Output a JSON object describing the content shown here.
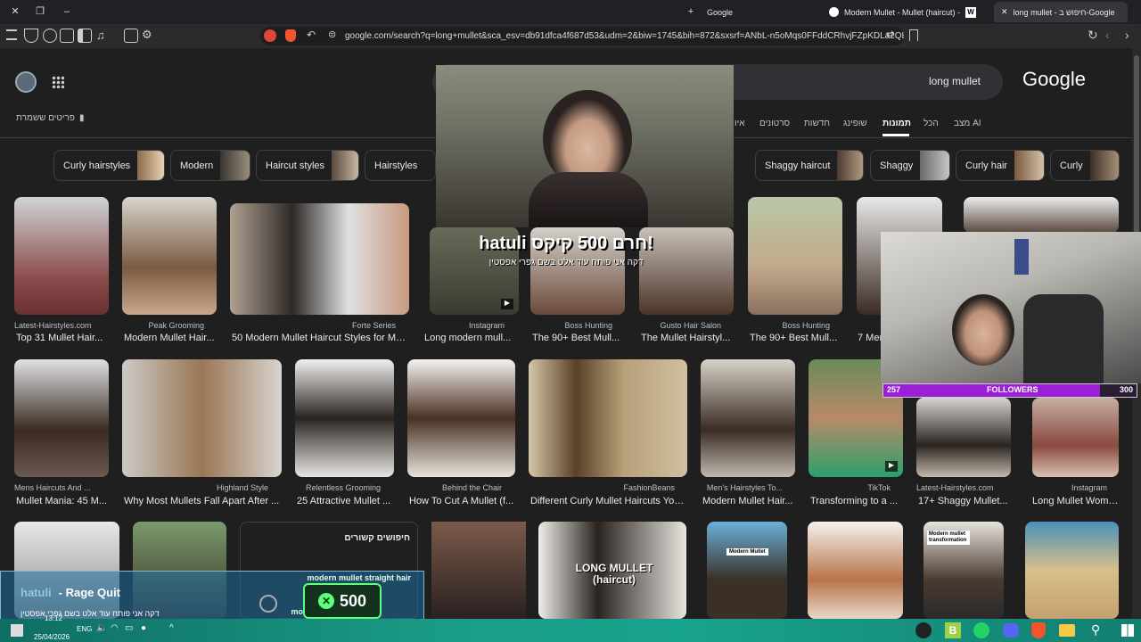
{
  "browser": {
    "tabs": [
      {
        "label": "Google"
      },
      {
        "label": "Modern Mullet - Mullet (haircut) - W"
      },
      {
        "label": "long mullet - חיפוש ב-Google"
      }
    ],
    "url": "google.com/search?q=long+mullet&sca_esv=db91dfca4f687d53&udm=2&biw=1745&bih=872&sxsrf=ANbL-n5oMqs0FFddCRhvjFZpKDLa2QE..."
  },
  "google": {
    "logo": "Google",
    "query": "long mullet",
    "saved_items": "פריטים ששמרת",
    "tabs": [
      "מצב AI",
      "הכל",
      "תמונות",
      "שופינג",
      "חדשות",
      "סרטונים",
      "איו"
    ],
    "active_tab_index": 2,
    "chips": [
      {
        "label": "Curly hairstyles"
      },
      {
        "label": "Modern"
      },
      {
        "label": "Haircut styles"
      },
      {
        "label": "Hairstyles"
      },
      {
        "label": "Shaggy haircut"
      },
      {
        "label": "Shaggy"
      },
      {
        "label": "Curly hair"
      },
      {
        "label": "Curly"
      }
    ],
    "row1": [
      {
        "source": "Latest-Hairstyles.com",
        "title": "Top 31 Mullet Hair..."
      },
      {
        "source": "Peak Grooming",
        "title": "Modern Mullet Hair..."
      },
      {
        "source": "Forte Series",
        "title": "50 Modern Mullet Haircut Styles for Me..."
      },
      {
        "source": "Instagram",
        "title": "Long modern mull..."
      },
      {
        "source": "Boss Hunting",
        "title": "The 90+ Best Mull..."
      },
      {
        "source": "Gusto Hair Salon",
        "title": "The Mullet Hairstyl..."
      },
      {
        "source": "Boss Hunting",
        "title": "The 90+ Best Mull..."
      },
      {
        "source": "",
        "title": "7 Mer"
      }
    ],
    "row2": [
      {
        "source": "Mens Haircuts And ...",
        "title": "Mullet Mania: 45 M..."
      },
      {
        "source": "Highland Style",
        "title": "Why Most Mullets Fall Apart After ..."
      },
      {
        "source": "Relentless Grooming",
        "title": "25 Attractive Mullet ..."
      },
      {
        "source": "Behind the Chair",
        "title": "How To Cut A Mullet (f..."
      },
      {
        "source": "FashionBeans",
        "title": "Different Curly Mullet Haircuts You..."
      },
      {
        "source": "Men's Hairstyles To...",
        "title": "Modern Mullet Hair..."
      },
      {
        "source": "TikTok",
        "title": "Transforming to a ..."
      },
      {
        "source": "Latest-Hairstyles.com",
        "title": "17+ Shaggy Mullet..."
      },
      {
        "source": "Instagram",
        "title": "Long Mullet Woman"
      }
    ],
    "related": {
      "heading": "חיפושים קשורים",
      "items": [
        "modern mullet straight hair",
        "modern mullet haircut"
      ]
    },
    "row3_labels": [
      "Modern Mullet",
      "Modern mullet transformation",
      "LONG MULLET (haircut)"
    ]
  },
  "stream": {
    "promo_title": "!חרם 500 קיקס hatuli",
    "promo_sub": "דקה אני פותח עוד אלט בשם גפרי אפסטין",
    "followers_label": "FOLLOWERS",
    "followers_current": "257",
    "followers_goal": "300",
    "followers_fraction": 0.857,
    "rage_name": "hatuli",
    "rage_text": "- Rage Quit",
    "rage_sub": "דקה אני פותח עוד אלט בשם גפרי אפסטין",
    "badge_amount": "500"
  },
  "taskbar": {
    "time": "13:12",
    "date": "25/04/2026",
    "lang": "ENG"
  },
  "colors": {
    "page_bg": "#1f1f1f",
    "accent_green": "#5dff7a",
    "followers_purple": "#9b1fd6"
  }
}
